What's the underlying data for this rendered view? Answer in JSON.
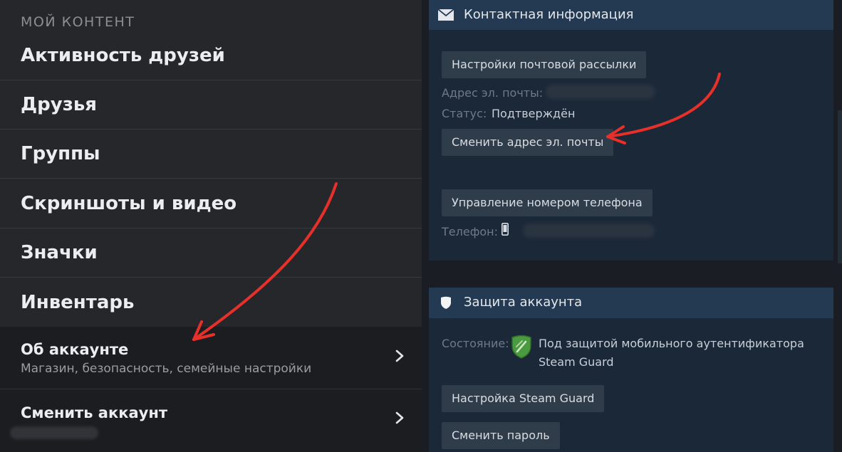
{
  "left": {
    "section_title": "МОЙ КОНТЕНТ",
    "items": [
      {
        "label": "Активность друзей"
      },
      {
        "label": "Друзья"
      },
      {
        "label": "Группы"
      },
      {
        "label": "Скриншоты и видео"
      },
      {
        "label": "Значки"
      },
      {
        "label": "Инвентарь"
      }
    ],
    "account": {
      "label": "Об аккаунте",
      "sub": "Магазин, безопасность, семейные настройки"
    },
    "switch_account": {
      "label": "Сменить аккаунт"
    }
  },
  "contact": {
    "title": "Контактная информация",
    "newsletter_button": "Настройки почтовой рассылки",
    "email_label": "Адрес эл. почты:",
    "status_label": "Статус:",
    "status_value": "Подтверждён",
    "change_email_button": "Сменить адрес эл. почты",
    "phone_button": "Управление номером телефона",
    "phone_label": "Телефон:"
  },
  "security": {
    "title": "Защита аккаунта",
    "state_label": "Состояние:",
    "state_value_1": "Под защитой мобильного аутентификатора",
    "state_value_2": "Steam Guard",
    "steam_guard_button": "Настройка Steam Guard",
    "change_password_button": "Сменить пароль"
  },
  "colors": {
    "left_bg": "#25272b",
    "card_header": "#243a52",
    "card_bg": "#1b2838",
    "arrow": "#e8302a",
    "shield_green": "#3f8a3a"
  }
}
